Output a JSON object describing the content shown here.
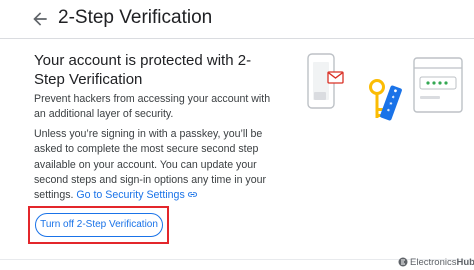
{
  "header": {
    "back_icon": "arrow-back-icon",
    "title": "2-Step Verification"
  },
  "card": {
    "heading": "Your account is protected with 2-Step Verification",
    "paragraph1": "Prevent hackers from accessing your account with an additional layer of security.",
    "paragraph2": "Unless you’re signing in with a passkey, you’ll be asked to complete the most secure second step available on your account. You can update your second steps and sign-in options any time in your settings.",
    "security_settings_link": "Go to Security Settings",
    "link_icon": "link-icon"
  },
  "actions": {
    "turn_off_label": "Turn off 2-Step Verification"
  },
  "illustration": {
    "icon": "phone-key-password-illustration",
    "password_dots": "****"
  },
  "watermark": {
    "light": "Electronics",
    "bold": "Hub"
  },
  "colors": {
    "accent": "#1a73e8",
    "highlight": "#e3262b",
    "key_yellow": "#fbbc04",
    "tag_blue": "#1a73e8",
    "mail_red": "#d93025"
  }
}
